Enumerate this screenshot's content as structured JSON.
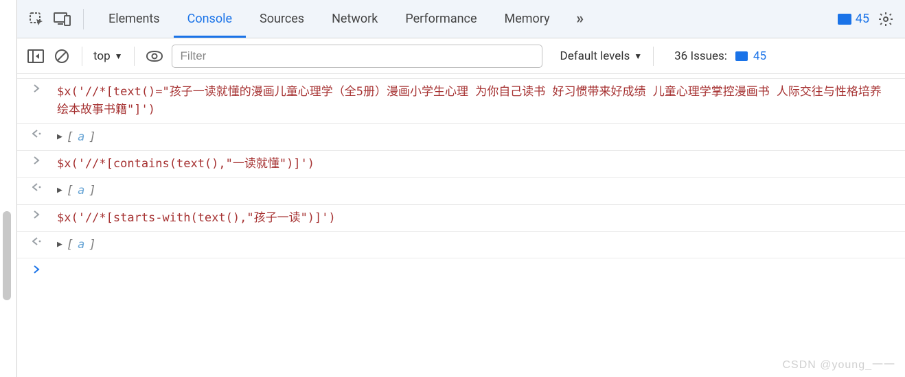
{
  "tabs": {
    "items": [
      "Elements",
      "Console",
      "Sources",
      "Network",
      "Performance",
      "Memory"
    ],
    "activeIndex": 1
  },
  "header": {
    "messageCount": "45"
  },
  "toolbar": {
    "context": "top",
    "filterPlaceholder": "Filter",
    "levelsLabel": "Default levels",
    "issuesLabel": "36 Issues:",
    "issuesCount": "45"
  },
  "console": {
    "entries": [
      {
        "type": "input",
        "code": "$x('//*[text()=\"孩子一读就懂的漫画儿童心理学（全5册）漫画小学生心理 为你自己读书 好习惯带来好成绩 儿童心理学掌控漫画书 人际交往与性格培养绘本故事书籍\"]')"
      },
      {
        "type": "output",
        "label": "a"
      },
      {
        "type": "input",
        "code": "$x('//*[contains(text(),\"一读就懂\")]')"
      },
      {
        "type": "output",
        "label": "a"
      },
      {
        "type": "input",
        "code": "$x('//*[starts-with(text(),\"孩子一读\")]')"
      },
      {
        "type": "output",
        "label": "a"
      }
    ]
  },
  "watermark": "CSDN @young_一一"
}
